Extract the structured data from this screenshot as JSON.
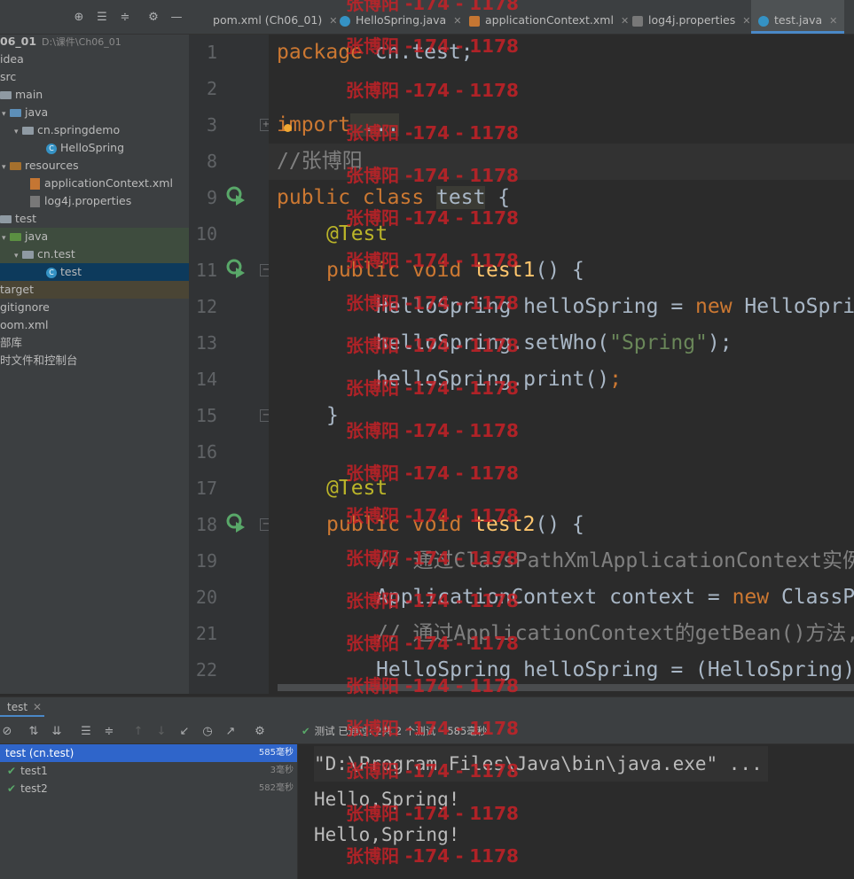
{
  "project": {
    "root_name": "06_01",
    "root_path": "D:\\课件\\Ch06_01",
    "tree": [
      {
        "label": "idea"
      },
      {
        "label": "src"
      },
      {
        "label": "main"
      },
      {
        "label": "java"
      },
      {
        "label": "cn.springdemo"
      },
      {
        "label": "HelloSpring"
      },
      {
        "label": "resources"
      },
      {
        "label": "applicationContext.xml"
      },
      {
        "label": "log4j.properties"
      },
      {
        "label": "test"
      },
      {
        "label": "java"
      },
      {
        "label": "cn.test"
      },
      {
        "label": "test"
      },
      {
        "label": "target"
      },
      {
        "label": "gitignore"
      },
      {
        "label": "oom.xml"
      },
      {
        "label": "部库"
      },
      {
        "label": "时文件和控制台"
      }
    ]
  },
  "tabs": [
    {
      "label": "pom.xml (Ch06_01)",
      "icon": "maven-icon"
    },
    {
      "label": "HelloSpring.java",
      "icon": "class-icon"
    },
    {
      "label": "applicationContext.xml",
      "icon": "xml-icon"
    },
    {
      "label": "log4j.properties",
      "icon": "properties-icon"
    },
    {
      "label": "test.java",
      "icon": "test-class-icon",
      "active": true
    }
  ],
  "editor": {
    "line_numbers": [
      "1",
      "2",
      "3",
      "8",
      "9",
      "10",
      "11",
      "12",
      "13",
      "14",
      "15",
      "16",
      "17",
      "18",
      "19",
      "20",
      "21",
      "22"
    ],
    "code": {
      "l1_kw": "package",
      "l1_rest": " cn.test;",
      "l3_kw": "import",
      "l3_rest": " ...",
      "l8": "//张博阳",
      "l9_kw": "public class",
      "l9_name": "test",
      "l9_rest": " {",
      "l10": "@Test",
      "l11_kw": "public void",
      "l11_fn": "test1",
      "l11_rest": "() {",
      "l12_a": "HelloSpring helloSpring = ",
      "l12_kw": "new",
      "l12_b": " HelloSpri",
      "l13_a": "helloSpring.setWho(",
      "l13_str": "\"Spring\"",
      "l13_b": ");",
      "l14_a": "helloSpring.print()",
      "l14_b": ";",
      "l15": "}",
      "l17": "@Test",
      "l18_kw": "public void",
      "l18_fn": "test2",
      "l18_rest": "() {",
      "l19": "// 通过ClassPathXmlApplicationContext实例",
      "l20_a": "ApplicationContext context = ",
      "l20_kw": "new",
      "l20_b": " ClassP",
      "l21": "// 通过ApplicationContext的getBean()方法,",
      "l22": "HelloSpring helloSpring = (HelloSpring)"
    }
  },
  "watermark": "张博阳 -174 - 1178",
  "run": {
    "tab_label": "test",
    "status": "测试 已通过: 2共 2 个测试 – 585毫秒",
    "tests": [
      {
        "name": "test (cn.test)",
        "time": "585毫秒"
      },
      {
        "name": "test1",
        "time": "3毫秒"
      },
      {
        "name": "test2",
        "time": "582毫秒"
      }
    ],
    "console": [
      "\"D:\\Program Files\\Java\\bin\\java.exe\" ...",
      "Hello,Spring!",
      "Hello,Spring!"
    ]
  },
  "colors": {
    "keyword": "#cc7832",
    "annotation": "#bbb529",
    "function": "#ffc66d",
    "string": "#6a8759",
    "comment": "#808080",
    "watermark": "#cc2127",
    "selection": "#2f65ca"
  }
}
